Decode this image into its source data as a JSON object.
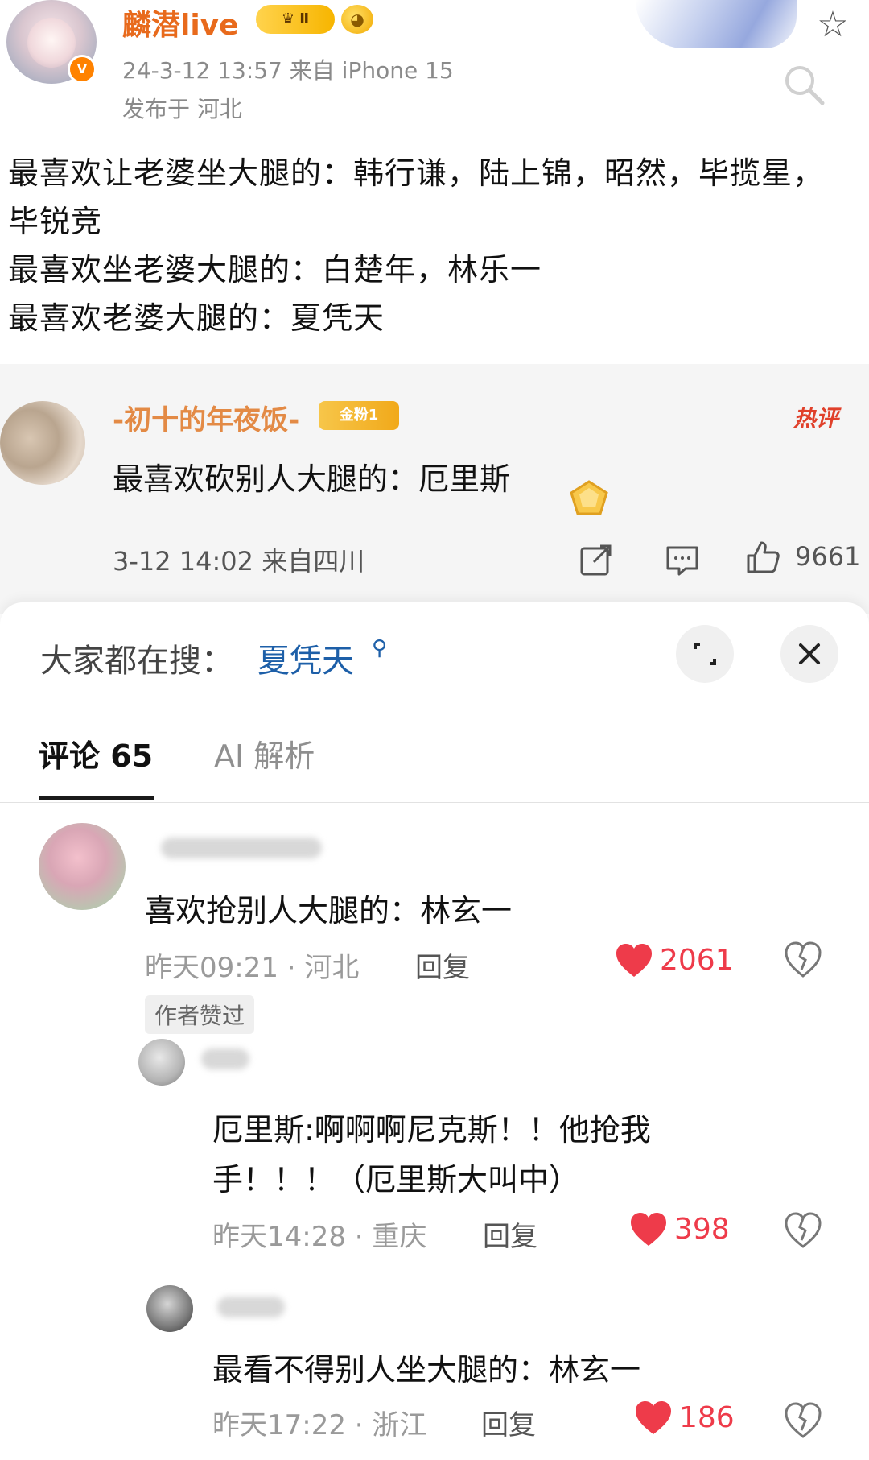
{
  "post": {
    "author": "麟潜live",
    "vip_badge": "Ⅱ",
    "time_source": "24-3-12 13:57   来自 iPhone 15",
    "location": "发布于 河北",
    "lines": [
      "最喜欢让老婆坐大腿的：韩行谦，陆上锦，昭然，毕揽星，",
      "毕锐竞",
      "最喜欢坐老婆大腿的：白楚年，林乐一",
      "最喜欢老婆大腿的：夏凭天"
    ]
  },
  "hot_comment": {
    "user": "-初十的年夜饭-",
    "fan_badge": "金粉1",
    "tag": "热评",
    "text": "最喜欢砍别人大腿的：厄里斯",
    "time_source": "3-12 14:02  来自四川",
    "likes": "9661"
  },
  "sheet": {
    "trend_label": "大家都在搜：",
    "trend_term": "夏凭天",
    "tabs": {
      "comments": "评论 65",
      "ai": "AI 解析"
    }
  },
  "comments": [
    {
      "text": "喜欢抢别人大腿的：林玄一",
      "meta": "昨天09:21 · 河北",
      "reply": "回复",
      "likes": "2061",
      "author_liked": "作者赞过"
    },
    {
      "line1": "厄里斯:啊啊啊尼克斯！！他抢我",
      "line2": "手！！！（厄里斯大叫中）",
      "meta": "昨天14:28 · 重庆",
      "reply": "回复",
      "likes": "398"
    },
    {
      "text": "最看不得别人坐大腿的：林玄一",
      "meta": "昨天17:22 · 浙江",
      "reply": "回复",
      "likes": "186"
    }
  ],
  "colors": {
    "username": "#e86a1c",
    "hot_user": "#e38a45",
    "hot_tag": "#e0402a",
    "trend_term": "#1d5fa8",
    "like_red": "#ee3b4a"
  }
}
